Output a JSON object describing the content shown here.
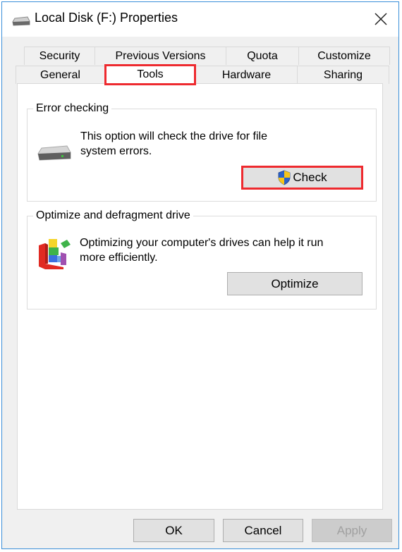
{
  "window": {
    "title": "Local Disk (F:) Properties",
    "title_icon": "drive-icon",
    "close_icon": "close-icon"
  },
  "tabs": {
    "row1": [
      {
        "label": "Security"
      },
      {
        "label": "Previous Versions"
      },
      {
        "label": "Quota"
      },
      {
        "label": "Customize"
      }
    ],
    "row2": [
      {
        "label": "General"
      },
      {
        "label": "Tools",
        "active": true
      },
      {
        "label": "Hardware"
      },
      {
        "label": "Sharing"
      }
    ]
  },
  "error_checking": {
    "title": "Error checking",
    "description_line1": "This option will check the drive for file",
    "description_line2": "system errors.",
    "icon": "hard-drive-icon",
    "button_icon": "uac-shield-icon",
    "button_label": "Check"
  },
  "optimize": {
    "title": "Optimize and defragment drive",
    "description_line1": "Optimizing your computer's drives can help it run",
    "description_line2": "more efficiently.",
    "icon": "defragment-icon",
    "button_label": "Optimize"
  },
  "footer": {
    "ok_label": "OK",
    "cancel_label": "Cancel",
    "apply_label": "Apply"
  },
  "colors": {
    "highlight": "#ee2a2f",
    "window_border": "#3b8fd9",
    "dialog_bg": "#f0f0f0"
  }
}
